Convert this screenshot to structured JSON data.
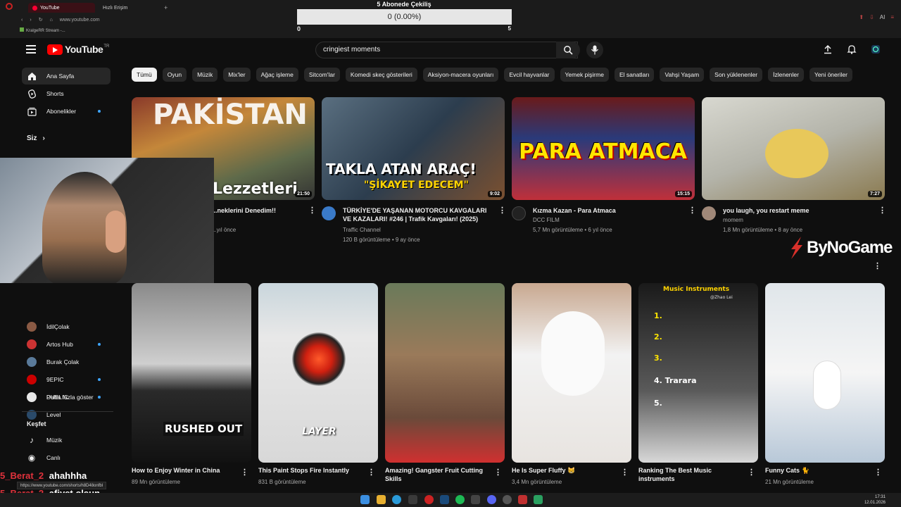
{
  "browser": {
    "tabs": [
      {
        "label": "YouTube",
        "active": true
      },
      {
        "label": "Hızlı Erişim",
        "active": false
      }
    ],
    "url": "www.youtube.com",
    "bookmark": "KralgeRR Stream -...",
    "ext_label": "AI"
  },
  "giveaway": {
    "title": "5 Abonede Çekiliş",
    "progress_text": "0 (0.00%)",
    "progress": 0,
    "min": "0",
    "max": "5"
  },
  "youtube": {
    "logo_text": "YouTube",
    "logo_region": "TR",
    "search": {
      "query": "cringiest moments"
    },
    "chips": [
      "Tümü",
      "Oyun",
      "Müzik",
      "Mix'ler",
      "Ağaç işleme",
      "Sitcom'lar",
      "Komedi skeç gösterileri",
      "Aksiyon-macera oyunları",
      "Evcil hayvanlar",
      "Yemek pişirme",
      "El sanatları",
      "Vahşi Yaşam",
      "Son yüklenenler",
      "İzlenenler",
      "Yeni öneriler"
    ],
    "sidebar": {
      "main": [
        {
          "label": "Ana Sayfa",
          "icon": "home-icon"
        },
        {
          "label": "Shorts",
          "icon": "shorts-icon"
        },
        {
          "label": "Abonelikler",
          "icon": "subscriptions-icon"
        }
      ],
      "you_label": "Siz",
      "subscriptions": [
        {
          "label": "İdilÇolak",
          "color": "#8a5a44",
          "dot": false
        },
        {
          "label": "Artos Hub",
          "color": "#c33",
          "dot": true
        },
        {
          "label": "Burak Çolak",
          "color": "#5a7a9a",
          "dot": false
        },
        {
          "label": "9EPIC",
          "color": "#c00",
          "dot": true
        },
        {
          "label": "PUBLIC",
          "color": "#e8e8e8",
          "dot": true
        },
        {
          "label": "Level",
          "color": "#2a4a6a",
          "dot": false
        }
      ],
      "show_more": "Daha fazla göster",
      "explore_label": "Keşfet",
      "explore": [
        {
          "label": "Müzik",
          "icon": "music-icon"
        },
        {
          "label": "Canlı",
          "icon": "live-icon"
        }
      ]
    },
    "videos": [
      {
        "title": "...neklerini Denedim!!",
        "meta_line1": "",
        "meta_line2": "...yıl önce",
        "duration": "21:50",
        "thumb_text": "Lezzetleri",
        "thumb_top": "PAKİSTAN"
      },
      {
        "title": "TÜRKİYE'DE YAŞANAN MOTORCU KAVGALARI VE KAZALARI! #246 | Trafik Kavgaları! (2025)",
        "channel": "Traffic Channel",
        "meta": "120 B görüntüleme • 9 ay önce",
        "duration": "9:02",
        "thumb_text": "TAKLA ATAN ARAÇ!",
        "thumb_sub": "\"ŞİKAYET EDECEM\""
      },
      {
        "title": "Kızma Kazan - Para Atmaca",
        "channel": "DCC FILM",
        "meta": "5,7 Mn görüntüleme • 6 yıl önce",
        "duration": "15:15",
        "thumb_text": "PARA ATMACA"
      },
      {
        "title": "you laugh, you restart meme",
        "channel": "momem",
        "meta": "1,8 Mn görüntüleme • 8 ay önce",
        "duration": "7:27"
      }
    ],
    "shorts": [
      {
        "title": "How to Enjoy Winter in China",
        "meta": "89 Mn görüntüleme",
        "thumb_text": "RUSHED OUT"
      },
      {
        "title": "This Paint Stops Fire Instantly",
        "meta": "831 B görüntüleme",
        "thumb_text": "LAYER"
      },
      {
        "title": "Amazing! Gangster Fruit Cutting Skills",
        "meta": ""
      },
      {
        "title": "He Is Super Fluffy 😸",
        "meta": "3,4 Mn görüntüleme"
      },
      {
        "title": "Ranking The Best Music instruments",
        "meta": "",
        "thumb_text": "Music Instruments",
        "list": [
          "1.",
          "2.",
          "3.",
          "4. Trarara",
          "5."
        ],
        "watermark": "@Zhao Lei"
      },
      {
        "title": "Funny Cats 🐈",
        "meta": "21 Mn görüntüleme"
      }
    ]
  },
  "overlay": {
    "sponsor": "ByNoGame",
    "chat": [
      {
        "user": "5_Berat_2",
        "message": "ahahhha"
      },
      {
        "user": "5_Berat_2",
        "message": "afiyet olsun"
      }
    ],
    "url_tooltip": "https://www.youtube.com/shorts/h8D48onfbl"
  },
  "taskbar": {
    "time": "17:31",
    "date": "12.01.2026"
  }
}
